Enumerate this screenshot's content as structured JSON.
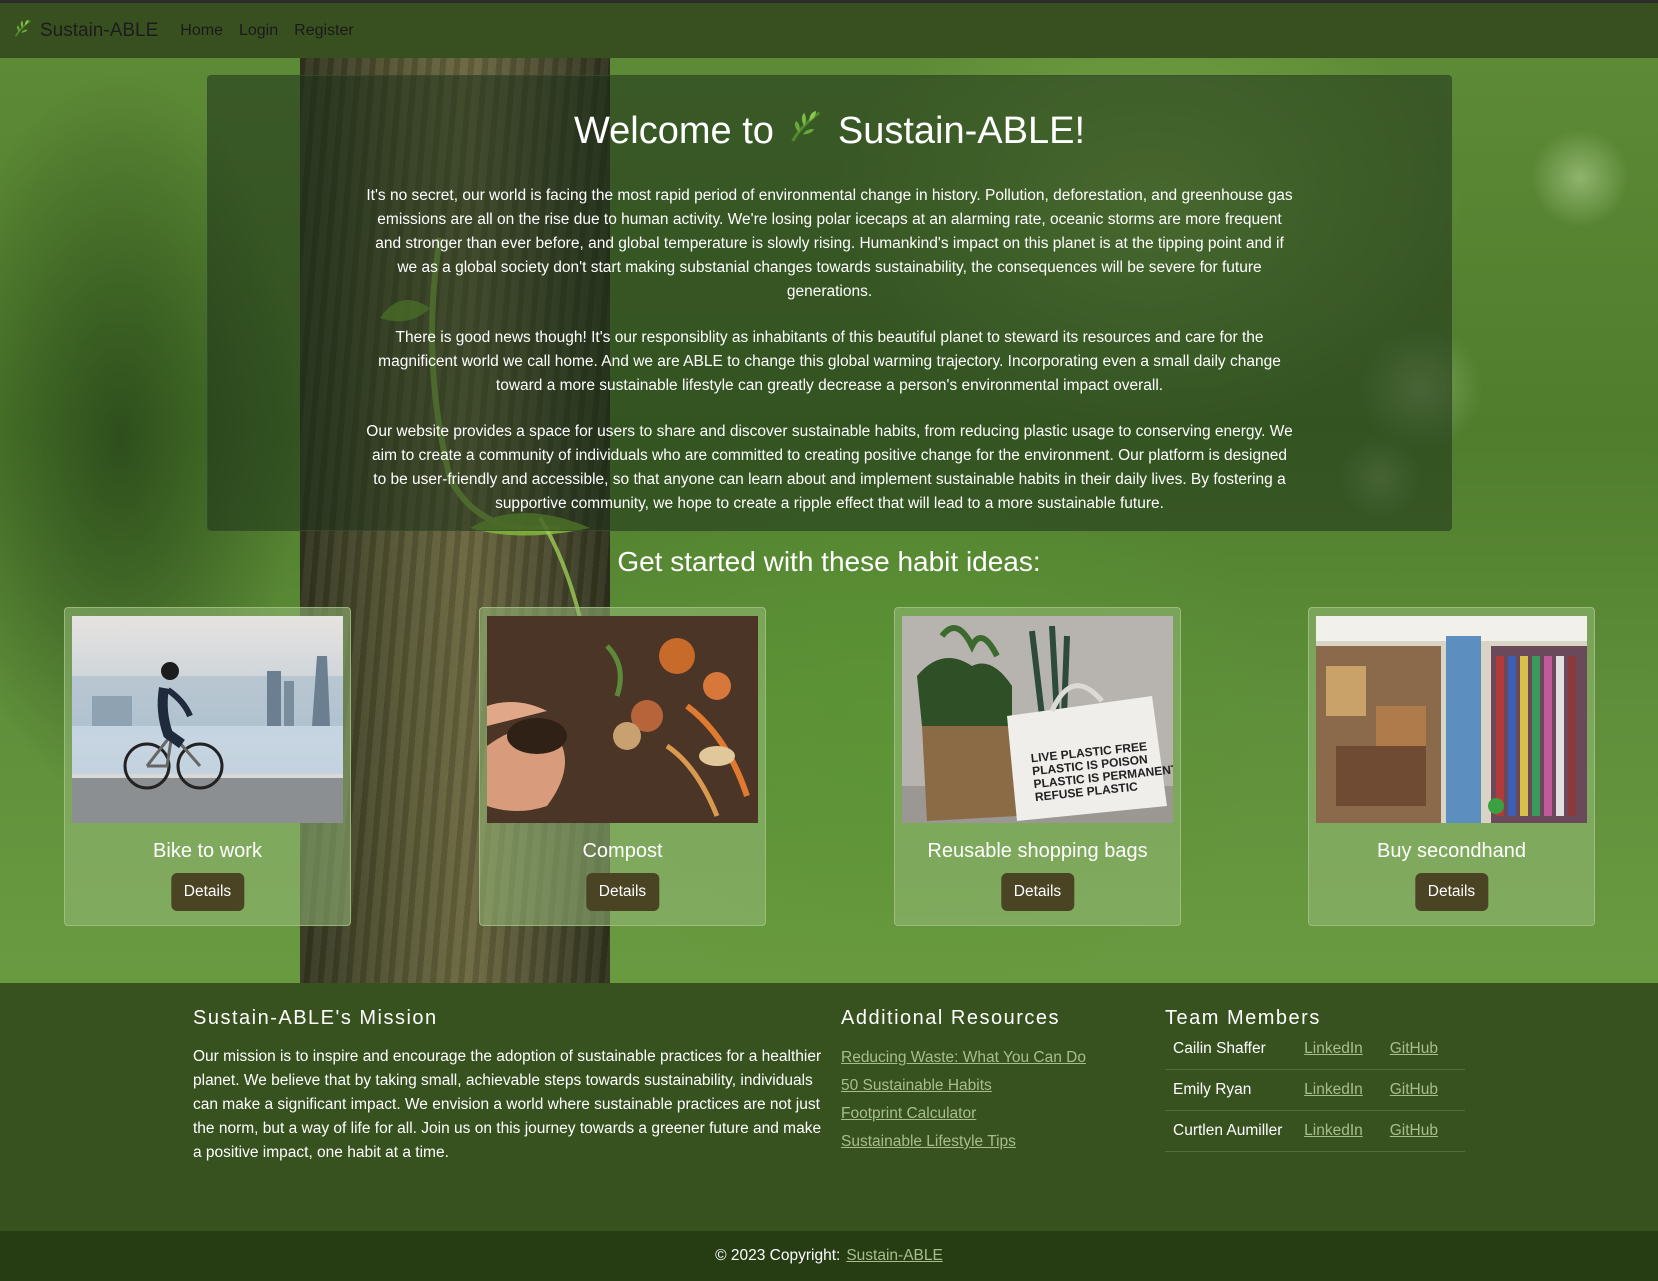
{
  "nav": {
    "brand": "Sustain-ABLE",
    "links": [
      "Home",
      "Login",
      "Register"
    ]
  },
  "welcome": {
    "title_prefix": "Welcome to",
    "title_brand": "Sustain-ABLE!",
    "paragraphs": [
      "It's no secret, our world is facing the most rapid period of environmental change in history. Pollution, deforestation, and greenhouse gas emissions are all on the rise due to human activity. We're losing polar icecaps at an alarming rate, oceanic storms are more frequent and stronger than ever before, and global temperature is slowly rising. Humankind's impact on this planet is at the tipping point and if we as a global society don't start making substanial changes towards sustainability, the consequences will be severe for future generations.",
      "There is good news though! It's our responsiblity as inhabitants of this beautiful planet to steward its resources and care for the magnificent world we call home. And we are ABLE to change this global warming trajectory. Incorporating even a small daily change toward a more sustainable lifestyle can greatly decrease a person's environmental impact overall.",
      "Our website provides a space for users to share and discover sustainable habits, from reducing plastic usage to conserving energy. We aim to create a community of individuals who are committed to creating positive change for the environment. Our platform is designed to be user-friendly and accessible, so that anyone can learn about and implement sustainable habits in their daily lives. By fostering a supportive community, we hope to create a ripple effect that will lead to a more sustainable future."
    ]
  },
  "habits": {
    "title": "Get started with these habit ideas:",
    "button_label": "Details",
    "cards": [
      {
        "title": "Bike to work"
      },
      {
        "title": "Compost"
      },
      {
        "title": "Reusable shopping bags",
        "bag_text": [
          "LIVE PLASTIC FREE",
          "PLASTIC IS POISON",
          "PLASTIC IS PERMANENT",
          "REFUSE PLASTIC"
        ]
      },
      {
        "title": "Buy secondhand"
      }
    ]
  },
  "footer": {
    "mission": {
      "heading": "Sustain-ABLE's Mission",
      "text": "Our mission is to inspire and encourage the adoption of sustainable practices for a healthier planet. We believe that by taking small, achievable steps towards sustainability, individuals can make a significant impact. We envision a world where sustainable practices are not just the norm, but a way of life for all. Join us on this journey towards a greener future and make a positive impact, one habit at a time."
    },
    "resources": {
      "heading": "Additional Resources",
      "links": [
        "Reducing Waste: What You Can Do",
        "50 Sustainable Habits",
        "Footprint Calculator",
        "Sustainable Lifestyle Tips"
      ]
    },
    "team": {
      "heading": "Team Members",
      "members": [
        {
          "name": "Cailin Shaffer",
          "linkedin": "LinkedIn",
          "github": "GitHub"
        },
        {
          "name": "Emily Ryan",
          "linkedin": "LinkedIn",
          "github": "GitHub"
        },
        {
          "name": "Curtlen Aumiller",
          "linkedin": "LinkedIn",
          "github": "GitHub"
        }
      ]
    },
    "copyright": {
      "text": "© 2023 Copyright:",
      "link": "Sustain-ABLE"
    }
  },
  "colors": {
    "nav_bg": "#38501f",
    "footer_bg": "#37511f",
    "copyright_bg": "#263d14",
    "button_bg": "#4a4324",
    "link": "#a9bd8c"
  },
  "icons": {
    "brand": "leaf-icon"
  }
}
